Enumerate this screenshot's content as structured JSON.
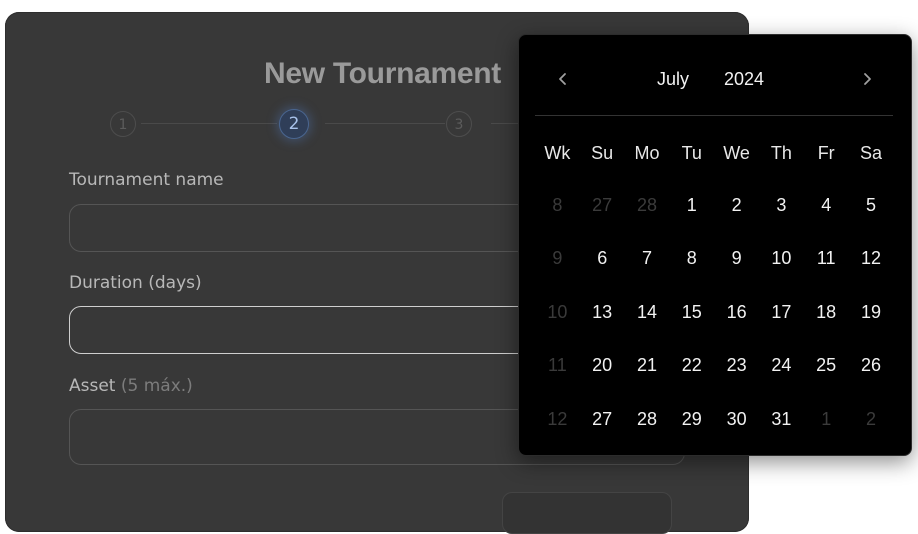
{
  "form": {
    "title": "New Tournament",
    "steps": [
      "1",
      "2",
      "3"
    ],
    "active_step": "2",
    "fields": [
      {
        "label": "Tournament name",
        "hint": "",
        "value": ""
      },
      {
        "label": "Duration (days)",
        "hint": "",
        "value": ""
      },
      {
        "label": "Asset",
        "hint": "(5 máx.)",
        "value": ""
      }
    ]
  },
  "picker": {
    "month": "July",
    "year": "2024",
    "prev_icon": "chevron-left-icon",
    "next_icon": "chevron-right-icon",
    "weekday_headers": [
      "Wk",
      "Su",
      "Mo",
      "Tu",
      "We",
      "Th",
      "Fr",
      "Sa"
    ],
    "weeks": [
      {
        "wk": "8",
        "days": [
          {
            "d": "27",
            "out": true
          },
          {
            "d": "28",
            "out": true
          },
          {
            "d": "1"
          },
          {
            "d": "2"
          },
          {
            "d": "3"
          },
          {
            "d": "4"
          },
          {
            "d": "5"
          }
        ]
      },
      {
        "wk": "9",
        "days": [
          {
            "d": "6"
          },
          {
            "d": "7"
          },
          {
            "d": "8"
          },
          {
            "d": "9"
          },
          {
            "d": "10"
          },
          {
            "d": "11"
          },
          {
            "d": "12"
          }
        ]
      },
      {
        "wk": "10",
        "days": [
          {
            "d": "13"
          },
          {
            "d": "14"
          },
          {
            "d": "15"
          },
          {
            "d": "16"
          },
          {
            "d": "17"
          },
          {
            "d": "18"
          },
          {
            "d": "19"
          }
        ]
      },
      {
        "wk": "11",
        "days": [
          {
            "d": "20"
          },
          {
            "d": "21"
          },
          {
            "d": "22"
          },
          {
            "d": "23"
          },
          {
            "d": "24"
          },
          {
            "d": "25"
          },
          {
            "d": "26"
          }
        ]
      },
      {
        "wk": "12",
        "days": [
          {
            "d": "27"
          },
          {
            "d": "28"
          },
          {
            "d": "29"
          },
          {
            "d": "30"
          },
          {
            "d": "31"
          },
          {
            "d": "1",
            "out": true
          },
          {
            "d": "2",
            "out": true
          }
        ]
      }
    ]
  }
}
